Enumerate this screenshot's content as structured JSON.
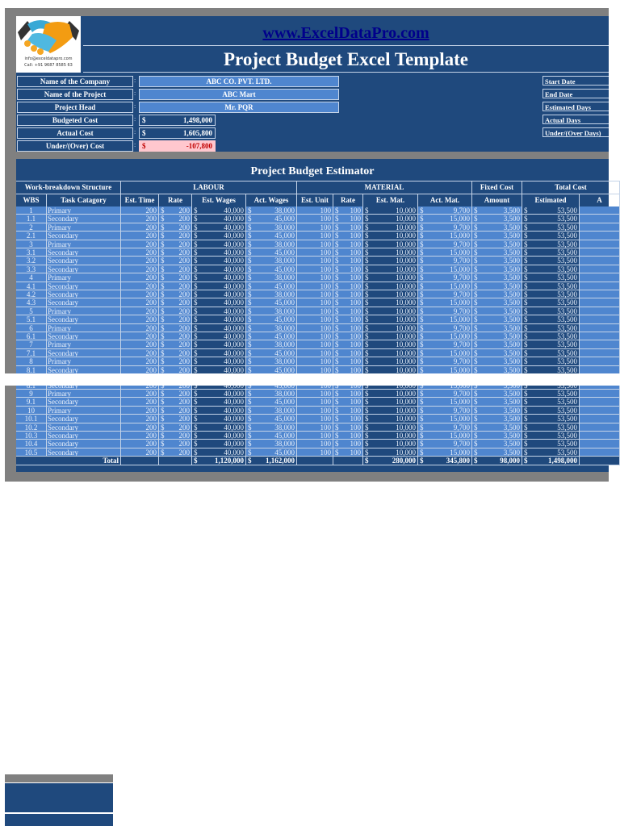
{
  "header": {
    "website": "www.ExcelDataPro.com",
    "title": "Project Budget Excel Template",
    "logo_email": "info@exceldatapro.com",
    "logo_phone": "Call: +91 9687 8585 63"
  },
  "info": {
    "company_label": "Name of the Company",
    "company": "ABC CO. PVT. LTD.",
    "project_label": "Name of the Project",
    "project": "ABC Mart",
    "head_label": "Project Head",
    "head": "Mr. PQR",
    "budgeted_label": "Budgeted Cost",
    "budgeted": "1,498,000",
    "actual_label": "Actual Cost",
    "actual": "1,605,800",
    "diff_label": "Under/(Over) Cost",
    "diff": "-107,800",
    "currency": "$",
    "colon": ":"
  },
  "dates": [
    "Start Date",
    "End Date",
    "Estimated Days",
    "Actual Days",
    "Under/(Over Days)"
  ],
  "estimator": {
    "title": "Project Budget Estimator",
    "groups": [
      "Work-breakdown Structure",
      "LABOUR",
      "MATERIAL",
      "Fixed Cost",
      "Total Cost"
    ],
    "columns": [
      "WBS",
      "Task Catagory",
      "Est. Time",
      "Rate",
      "Est. Wages",
      "Act. Wages",
      "Est. Unit",
      "Rate",
      "Est. Mat.",
      "Act. Mat.",
      "Amount",
      "Estimated",
      "A"
    ],
    "rows": [
      [
        "1",
        "Primary",
        "200",
        "200",
        "40,000",
        "38,000",
        "100",
        "100",
        "10,000",
        "9,700",
        "3,500",
        "53,500"
      ],
      [
        "1.1",
        "Secondary",
        "200",
        "200",
        "40,000",
        "45,000",
        "100",
        "100",
        "10,000",
        "15,000",
        "3,500",
        "53,500"
      ],
      [
        "2",
        "Primary",
        "200",
        "200",
        "40,000",
        "38,000",
        "100",
        "100",
        "10,000",
        "9,700",
        "3,500",
        "53,500"
      ],
      [
        "2.1",
        "Secondary",
        "200",
        "200",
        "40,000",
        "45,000",
        "100",
        "100",
        "10,000",
        "15,000",
        "3,500",
        "53,500"
      ],
      [
        "3",
        "Primary",
        "200",
        "200",
        "40,000",
        "38,000",
        "100",
        "100",
        "10,000",
        "9,700",
        "3,500",
        "53,500"
      ],
      [
        "3.1",
        "Secondary",
        "200",
        "200",
        "40,000",
        "45,000",
        "100",
        "100",
        "10,000",
        "15,000",
        "3,500",
        "53,500"
      ],
      [
        "3.2",
        "Secondary",
        "200",
        "200",
        "40,000",
        "38,000",
        "100",
        "100",
        "10,000",
        "9,700",
        "3,500",
        "53,500"
      ],
      [
        "3.3",
        "Secondary",
        "200",
        "200",
        "40,000",
        "45,000",
        "100",
        "100",
        "10,000",
        "15,000",
        "3,500",
        "53,500"
      ],
      [
        "4",
        "Primary",
        "200",
        "200",
        "40,000",
        "38,000",
        "100",
        "100",
        "10,000",
        "9,700",
        "3,500",
        "53,500"
      ],
      [
        "4.1",
        "Secondary",
        "200",
        "200",
        "40,000",
        "45,000",
        "100",
        "100",
        "10,000",
        "15,000",
        "3,500",
        "53,500"
      ],
      [
        "4.2",
        "Secondary",
        "200",
        "200",
        "40,000",
        "38,000",
        "100",
        "100",
        "10,000",
        "9,700",
        "3,500",
        "53,500"
      ],
      [
        "4.3",
        "Secondary",
        "200",
        "200",
        "40,000",
        "45,000",
        "100",
        "100",
        "10,000",
        "15,000",
        "3,500",
        "53,500"
      ],
      [
        "5",
        "Primary",
        "200",
        "200",
        "40,000",
        "38,000",
        "100",
        "100",
        "10,000",
        "9,700",
        "3,500",
        "53,500"
      ],
      [
        "5.1",
        "Secondary",
        "200",
        "200",
        "40,000",
        "45,000",
        "100",
        "100",
        "10,000",
        "15,000",
        "3,500",
        "53,500"
      ],
      [
        "6",
        "Primary",
        "200",
        "200",
        "40,000",
        "38,000",
        "100",
        "100",
        "10,000",
        "9,700",
        "3,500",
        "53,500"
      ],
      [
        "6.1",
        "Secondary",
        "200",
        "200",
        "40,000",
        "45,000",
        "100",
        "100",
        "10,000",
        "15,000",
        "3,500",
        "53,500"
      ],
      [
        "7",
        "Primary",
        "200",
        "200",
        "40,000",
        "38,000",
        "100",
        "100",
        "10,000",
        "9,700",
        "3,500",
        "53,500"
      ],
      [
        "7.1",
        "Secondary",
        "200",
        "200",
        "40,000",
        "45,000",
        "100",
        "100",
        "10,000",
        "15,000",
        "3,500",
        "53,500"
      ],
      [
        "8",
        "Primary",
        "200",
        "200",
        "40,000",
        "38,000",
        "100",
        "100",
        "10,000",
        "9,700",
        "3,500",
        "53,500"
      ],
      [
        "8.1",
        "Secondary",
        "200",
        "200",
        "40,000",
        "45,000",
        "100",
        "100",
        "10,000",
        "15,000",
        "3,500",
        "53,500"
      ],
      [
        "9",
        "Primary",
        "200",
        "200",
        "40,000",
        "38,000",
        "100",
        "100",
        "10,000",
        "9,700",
        "3,500",
        "53,500"
      ],
      [
        "9.1",
        "Secondary",
        "200",
        "200",
        "40,000",
        "45,000",
        "100",
        "100",
        "10,000",
        "15,000",
        "3,500",
        "53,500"
      ],
      [
        "10",
        "Primary",
        "200",
        "200",
        "40,000",
        "38,000",
        "100",
        "100",
        "10,000",
        "9,700",
        "3,500",
        "53,500"
      ],
      [
        "10.1",
        "Secondary",
        "200",
        "200",
        "40,000",
        "45,000",
        "100",
        "100",
        "10,000",
        "15,000",
        "3,500",
        "53,500"
      ],
      [
        "10.2",
        "Secondary",
        "200",
        "200",
        "40,000",
        "38,000",
        "100",
        "100",
        "10,000",
        "9,700",
        "3,500",
        "53,500"
      ],
      [
        "10.3",
        "Secondary",
        "200",
        "200",
        "40,000",
        "45,000",
        "100",
        "100",
        "10,000",
        "15,000",
        "3,500",
        "53,500"
      ],
      [
        "10.4",
        "Secondary",
        "200",
        "200",
        "40,000",
        "38,000",
        "100",
        "100",
        "10,000",
        "9,700",
        "3,500",
        "53,500"
      ],
      [
        "10.5",
        "Secondary",
        "200",
        "200",
        "40,000",
        "45,000",
        "100",
        "100",
        "10,000",
        "15,000",
        "3,500",
        "53,500"
      ]
    ],
    "total": {
      "label": "Total",
      "est_wages": "1,120,000",
      "act_wages": "1,162,000",
      "est_mat": "280,000",
      "act_mat": "345,800",
      "fixed": "98,000",
      "estimated": "1,498,000"
    }
  },
  "colors": {
    "navy": "#1f497d",
    "light": "#4f86cf",
    "frame": "#808080",
    "negative_bg": "#ffc7ce",
    "negative_text": "#c00000"
  }
}
